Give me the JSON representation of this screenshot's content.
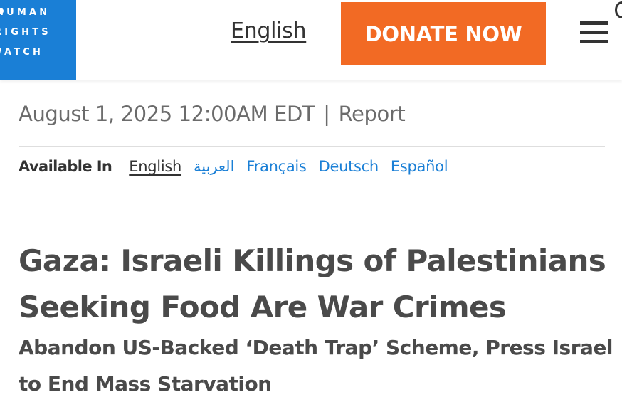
{
  "header": {
    "logo_lines": [
      "HUMAN",
      "RIGHTS",
      "WATCH"
    ],
    "language_label": "English",
    "donate_label": "DONATE NOW",
    "menu_icon": "hamburger-menu-icon"
  },
  "meta": {
    "date": "August 1, 2025 12:00AM EDT",
    "separator": "|",
    "type": "Report"
  },
  "available_in": {
    "label": "Available In",
    "languages": [
      "English",
      "العربية",
      "Français",
      "Deutsch",
      "Español"
    ]
  },
  "article": {
    "title": "Gaza: Israeli Killings of Palestinians Seeking Food Are War Crimes",
    "subtitle": "Abandon US-Backed ‘Death Trap’ Scheme, Press Israel to End Mass Starvation"
  },
  "colors": {
    "brand_blue": "#1a7fd6",
    "donate_orange": "#f26a24",
    "text_dark": "#333333",
    "text_muted": "#6b6b6b"
  }
}
